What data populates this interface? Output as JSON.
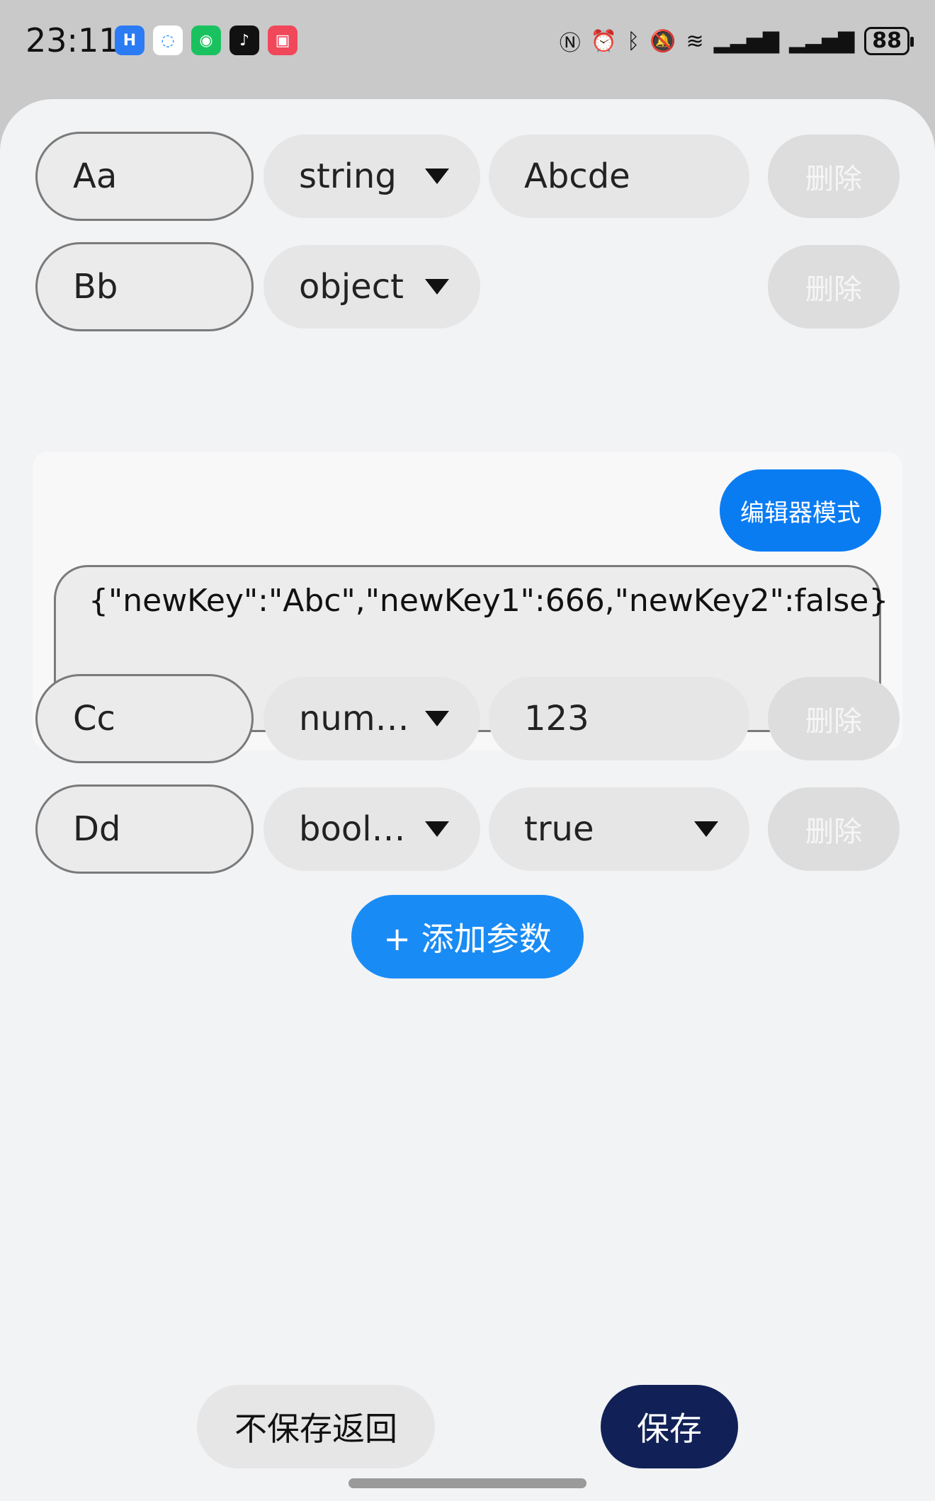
{
  "status": {
    "time": "23:11",
    "battery": "88",
    "apps": [
      {
        "icon": "harmony-app-icon",
        "color": "#2a7bf4",
        "glyph": "H"
      },
      {
        "icon": "chat-app-icon",
        "color": "#ffffff",
        "glyph": "◌"
      },
      {
        "icon": "wechat-icon",
        "color": "#19c25f",
        "glyph": "◉"
      },
      {
        "icon": "tiktok-icon",
        "color": "#111111",
        "glyph": "♪"
      },
      {
        "icon": "app-gallery-icon",
        "color": "#f0485a",
        "glyph": "▣"
      }
    ]
  },
  "params": [
    {
      "key": "Aa",
      "type": "string",
      "value": "Abcde",
      "delete": "删除"
    },
    {
      "key": "Bb",
      "type": "object",
      "value": "",
      "delete": "删除"
    },
    {
      "key": "Cc",
      "type": "num…",
      "value": "123",
      "delete": "删除"
    },
    {
      "key": "Dd",
      "type": "bool…",
      "value": "true",
      "delete": "删除"
    }
  ],
  "editor": {
    "mode_label": "编辑器模式",
    "json_text": "{\"newKey\":\"Abc\",\"newKey1\":666,\"newKey2\":false}"
  },
  "add_label": "+ 添加参数",
  "footer": {
    "back_label": "不保存返回",
    "save_label": "保存"
  }
}
